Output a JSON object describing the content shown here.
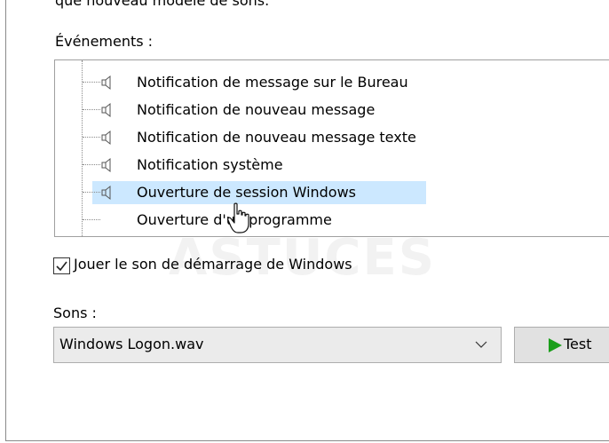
{
  "dialog": {
    "cut_text": "que nouveau modèle de sons.",
    "events_label": "Événements :",
    "events": [
      {
        "label": "Notification de message sur le Bureau",
        "has_sound": true,
        "selected": false
      },
      {
        "label": "Notification de nouveau message",
        "has_sound": true,
        "selected": false
      },
      {
        "label": "Notification de nouveau message texte",
        "has_sound": true,
        "selected": false
      },
      {
        "label": "Notification système",
        "has_sound": true,
        "selected": false
      },
      {
        "label": "Ouverture de session Windows",
        "has_sound": true,
        "selected": true
      },
      {
        "label": "Ouverture d'un programme",
        "has_sound": false,
        "selected": false
      }
    ],
    "watermark": "ASTUCES",
    "startup_sound": {
      "label": "Jouer le son de démarrage de Windows",
      "checked": true
    },
    "sounds_label": "Sons :",
    "sound_select": {
      "value": "Windows Logon.wav"
    },
    "test_button": {
      "label": "Test"
    }
  },
  "colors": {
    "selection": "#cce8ff",
    "play_green": "#1a9e1a",
    "border": "#a0a0a0"
  }
}
